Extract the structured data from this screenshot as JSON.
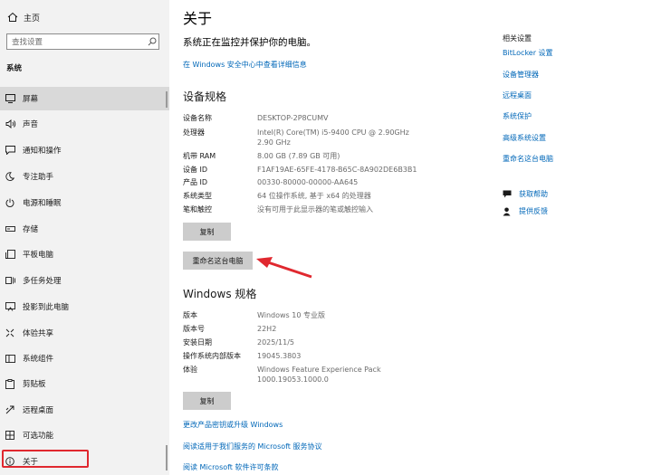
{
  "sidebar": {
    "home_label": "主页",
    "search_placeholder": "查找设置",
    "section_title": "系统",
    "items": [
      {
        "label": "屏幕",
        "icon": "monitor-icon"
      },
      {
        "label": "声音",
        "icon": "speaker-icon"
      },
      {
        "label": "通知和操作",
        "icon": "notification-icon"
      },
      {
        "label": "专注助手",
        "icon": "moon-icon"
      },
      {
        "label": "电源和睡眠",
        "icon": "power-icon"
      },
      {
        "label": "存储",
        "icon": "storage-icon"
      },
      {
        "label": "平板电脑",
        "icon": "tablet-icon"
      },
      {
        "label": "多任务处理",
        "icon": "multitask-icon"
      },
      {
        "label": "投影到此电脑",
        "icon": "project-icon"
      },
      {
        "label": "体验共享",
        "icon": "share-icon"
      },
      {
        "label": "系统组件",
        "icon": "components-icon"
      },
      {
        "label": "剪贴板",
        "icon": "clipboard-icon"
      },
      {
        "label": "远程桌面",
        "icon": "remote-icon"
      },
      {
        "label": "可选功能",
        "icon": "optional-features-icon"
      },
      {
        "label": "关于",
        "icon": "info-icon"
      }
    ],
    "selected_item": "屏幕"
  },
  "main": {
    "title": "关于",
    "status_text": "系统正在监控并保护你的电脑。",
    "security_link": "在 Windows 安全中心中查看详细信息",
    "device_specs": {
      "heading": "设备规格",
      "rows": [
        {
          "label": "设备名称",
          "value": "DESKTOP-2P8CUMV"
        },
        {
          "label": "处理器",
          "value": "Intel(R) Core(TM) i5-9400 CPU @ 2.90GHz   2.90 GHz"
        },
        {
          "label": "机带 RAM",
          "value": "8.00 GB (7.89 GB 可用)"
        },
        {
          "label": "设备 ID",
          "value": "F1AF19AE-65FE-4178-B65C-8A902DE6B3B1"
        },
        {
          "label": "产品 ID",
          "value": "00330-80000-00000-AA645"
        },
        {
          "label": "系统类型",
          "value": "64 位操作系统, 基于 x64 的处理器"
        },
        {
          "label": "笔和触控",
          "value": "没有可用于此显示器的笔或触控输入"
        }
      ],
      "copy_button": "复制",
      "rename_button": "重命名这台电脑"
    },
    "windows_specs": {
      "heading": "Windows 规格",
      "rows": [
        {
          "label": "版本",
          "value": "Windows 10 专业版"
        },
        {
          "label": "版本号",
          "value": "22H2"
        },
        {
          "label": "安装日期",
          "value": "2025/11/5"
        },
        {
          "label": "操作系统内部版本",
          "value": "19045.3803"
        },
        {
          "label": "体验",
          "value": "Windows Feature Experience Pack 1000.19053.1000.0"
        }
      ],
      "copy_button": "复制"
    },
    "bottom_links": [
      "更改产品密钥或升级 Windows",
      "阅读适用于我们服务的 Microsoft 服务协议",
      "阅读 Microsoft 软件许可条款"
    ]
  },
  "related": {
    "title": "相关设置",
    "links": [
      "BitLocker 设置",
      "设备管理器",
      "远程桌面",
      "系统保护",
      "高级系统设置",
      "重命名这台电脑"
    ],
    "help_items": [
      {
        "label": "获取帮助",
        "icon": "help-chat-icon"
      },
      {
        "label": "提供反馈",
        "icon": "feedback-icon"
      }
    ]
  },
  "colors": {
    "link": "#0067b8",
    "sidebar_bg": "#f2f2f2",
    "selected_bg": "#d9d9d9",
    "annotation_red": "#e0282f",
    "button_bg": "#cccccc"
  }
}
